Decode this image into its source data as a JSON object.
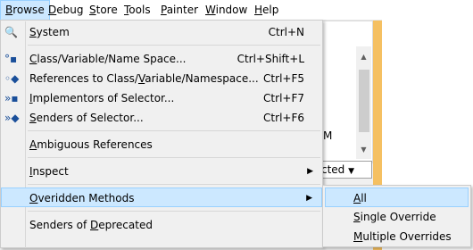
{
  "menubar": {
    "items": [
      "Browse",
      "Debug",
      "Store",
      "Tools",
      "Painter",
      "Window",
      "Help"
    ],
    "accels": [
      "B",
      "D",
      "S",
      "T",
      "P",
      "W",
      "H"
    ]
  },
  "background": {
    "fragment_text": "M",
    "combo_text": "cted"
  },
  "browse_menu": {
    "items": [
      {
        "label_pre": "",
        "label_acc": "S",
        "label_post": "ystem",
        "shortcut": "Ctrl+N",
        "icon": "system-browser-icon"
      },
      {
        "label_pre": "",
        "label_acc": "C",
        "label_post": "lass/Variable/Name Space...",
        "shortcut": "Ctrl+Shift+L",
        "icon": "binoculars-icon"
      },
      {
        "label_pre": "References to Class/",
        "label_acc": "V",
        "label_post": "ariable/Namespace...",
        "shortcut": "Ctrl+F5",
        "icon": "references-icon"
      },
      {
        "label_pre": "",
        "label_acc": "I",
        "label_post": "mplementors of Selector...",
        "shortcut": "Ctrl+F7",
        "icon": "implementors-icon"
      },
      {
        "label_pre": "",
        "label_acc": "S",
        "label_post": "enders of Selector...",
        "shortcut": "Ctrl+F6",
        "icon": "senders-icon"
      },
      {
        "label_pre": "",
        "label_acc": "A",
        "label_post": "mbiguous References",
        "shortcut": "",
        "icon": ""
      },
      {
        "label_pre": "",
        "label_acc": "I",
        "label_post": "nspect",
        "shortcut": "",
        "icon": ""
      },
      {
        "label_pre": "",
        "label_acc": "O",
        "label_post": "veridden Methods",
        "shortcut": "",
        "icon": ""
      },
      {
        "label_pre": "Senders of ",
        "label_acc": "D",
        "label_post": "eprecated",
        "shortcut": "",
        "icon": ""
      }
    ]
  },
  "overridden_submenu": {
    "items": [
      {
        "label_acc": "A",
        "label_post": "ll"
      },
      {
        "label_acc": "S",
        "label_post": "ingle Override"
      },
      {
        "label_acc": "M",
        "label_post": "ultiple Overrides"
      }
    ]
  },
  "colors": {
    "highlight": "#cce8ff",
    "highlight_border": "#99d1ff",
    "menu_bg": "#f0f0f0",
    "accent_orange": "#f5c062"
  }
}
